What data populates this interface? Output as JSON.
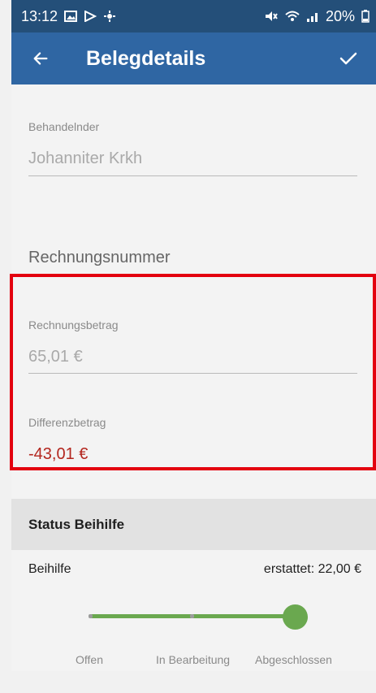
{
  "status_bar": {
    "time": "13:12",
    "left_icons": [
      "image-icon",
      "play-icon",
      "settings-icon"
    ],
    "right_icons": [
      "mute-icon",
      "wifi-icon",
      "signal-icon"
    ],
    "battery": "20%"
  },
  "app_bar": {
    "title": "Belegdetails",
    "back_icon": "arrow-left-icon",
    "confirm_icon": "check-icon"
  },
  "form": {
    "behandelnder": {
      "label": "Behandelnder",
      "value": "Johanniter Krkh"
    },
    "rechnungsnummer": {
      "placeholder": "Rechnungsnummer"
    },
    "rechnungsbetrag": {
      "label": "Rechnungsbetrag",
      "value": "65,01 €"
    },
    "differenzbetrag": {
      "label": "Differenzbetrag",
      "value": "-43,01 €"
    }
  },
  "status_beihilfe": {
    "header": "Status Beihilfe",
    "row_label": "Beihilfe",
    "row_value": "erstattet: 22,00 €",
    "steps": [
      "Offen",
      "In Bearbeitung",
      "Abgeschlossen"
    ],
    "selected_step_index": 2
  },
  "colors": {
    "status_bar_bg": "#244f79",
    "app_bar_bg": "#2f66a3",
    "accent_green": "#6aa84f",
    "negative_amount": "#b3261e",
    "highlight_border": "#e3000f"
  }
}
